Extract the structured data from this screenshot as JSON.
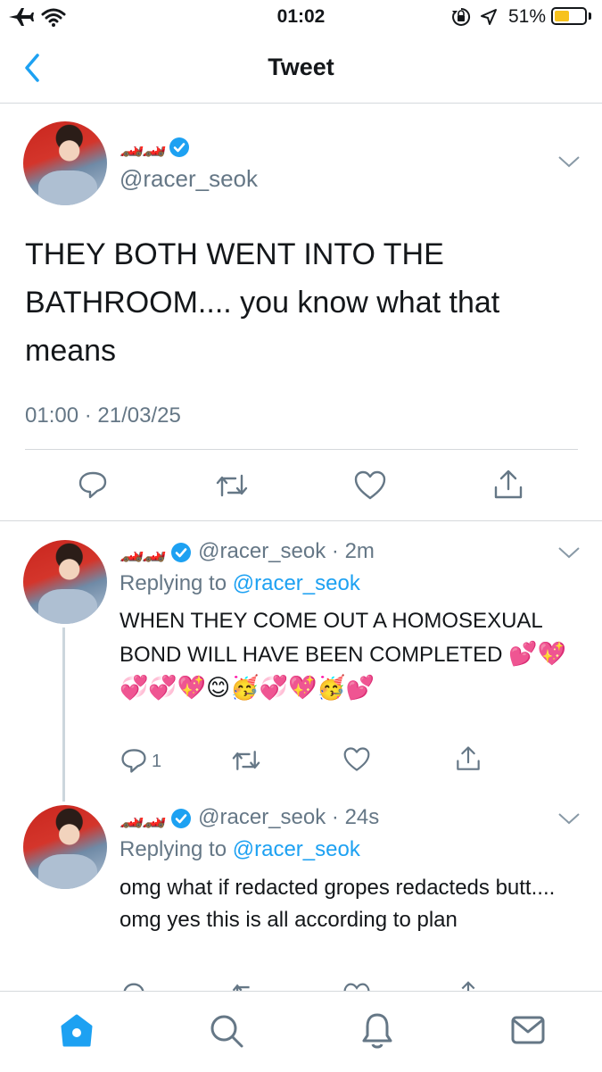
{
  "status_bar": {
    "time": "01:02",
    "battery_percent": "51%",
    "battery_level": 0.51,
    "icons": [
      "airplane-icon",
      "wifi-icon",
      "orientation-lock-icon",
      "location-icon",
      "battery-icon"
    ]
  },
  "nav": {
    "title": "Tweet",
    "back_icon": "chevron-left-icon"
  },
  "main_tweet": {
    "name_emojis": "🏎️🏎️",
    "handle": "@racer_seok",
    "text": "THEY BOTH WENT INTO THE BATHROOM.... you know what that means",
    "timestamp": "01:00 · 21/03/25",
    "actions": [
      "reply-icon",
      "retweet-icon",
      "like-icon",
      "share-icon"
    ]
  },
  "replies": [
    {
      "name_emojis": "🏎️🏎️",
      "handle": "@racer_seok",
      "time": "· 2m",
      "replying_prefix": "Replying to",
      "replying_to": "@racer_seok",
      "text": "WHEN THEY COME OUT A HOMOSEXUAL BOND WILL HAVE BEEN COMPLETED",
      "emojis": "💕💖💞💞💖😊🥳💞💖🥳💕",
      "reply_count": "1"
    },
    {
      "name_emojis": "🏎️🏎️",
      "handle": "@racer_seok",
      "time": "· 24s",
      "replying_prefix": "Replying to",
      "replying_to": "@racer_seok",
      "text": "omg what if redacted gropes redacteds butt.... omg yes this is all according to plan"
    }
  ],
  "colors": {
    "accent": "#1da1f2",
    "secondary_text": "#657786",
    "battery": "#f7c21e"
  },
  "tab_bar": [
    "home-icon",
    "search-icon",
    "notifications-icon",
    "messages-icon"
  ]
}
